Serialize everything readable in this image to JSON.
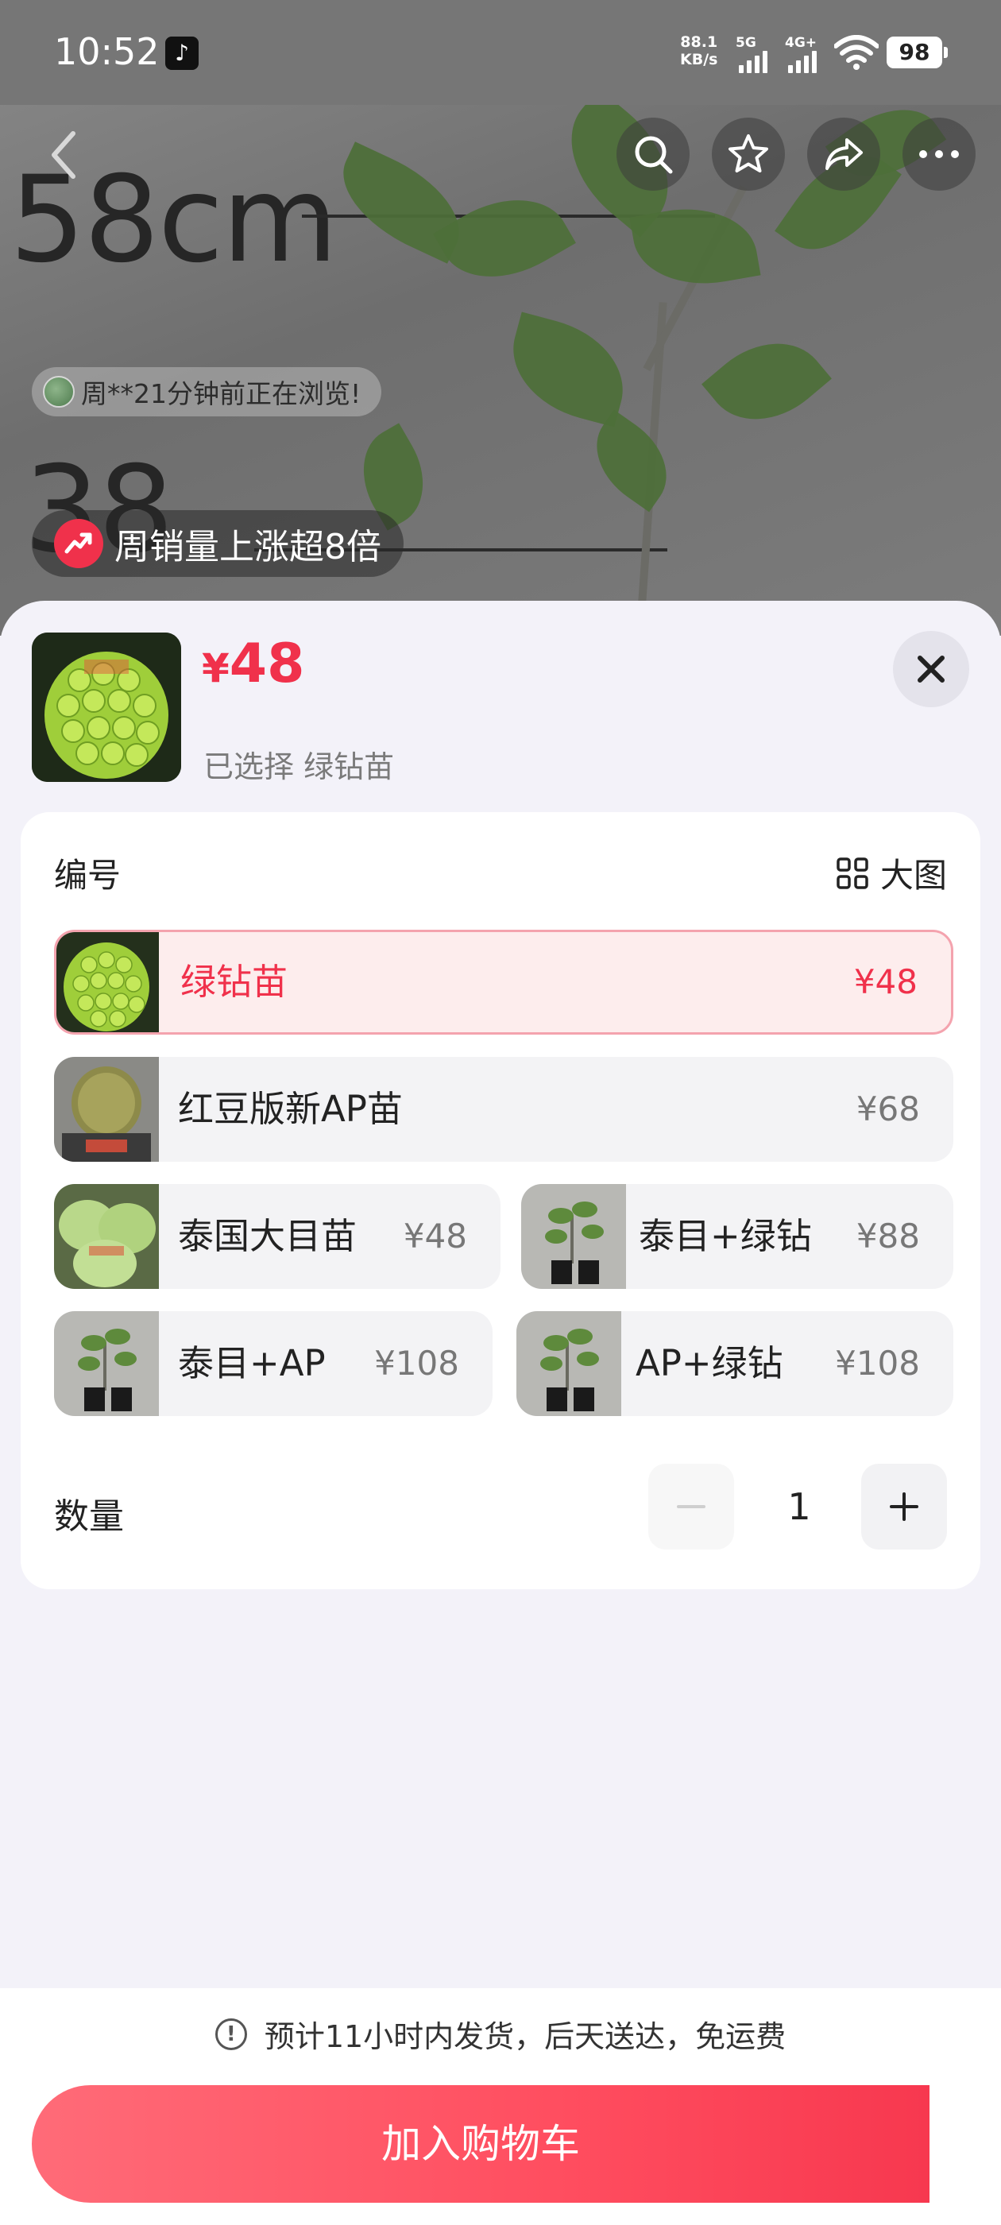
{
  "status_bar": {
    "time": "10:52",
    "net_speed_value": "88.1",
    "net_speed_unit": "KB/s",
    "signal1_label": "5G",
    "signal2_label": "4G+",
    "battery": "98"
  },
  "photo": {
    "ruler_top": "58cm",
    "ruler_mid": "38"
  },
  "top_actions": [
    "back",
    "search",
    "favorite",
    "share",
    "more"
  ],
  "viewer_notice": "周**21分钟前正在浏览!",
  "sales_badge": "周销量上涨超8倍",
  "sheet": {
    "price_symbol": "¥",
    "price": "48",
    "selected_text": "已选择 绿钻苗",
    "section_label": "编号",
    "big_image_label": "大图",
    "options": [
      {
        "name": "绿钻苗",
        "price": "¥48",
        "selected": true
      },
      {
        "name": "红豆版新AP苗",
        "price": "¥68",
        "selected": false
      },
      {
        "name": "泰国大目苗",
        "price": "¥48",
        "selected": false
      },
      {
        "name": "泰目+绿钻",
        "price": "¥88",
        "selected": false
      },
      {
        "name": "泰目+AP",
        "price": "¥108",
        "selected": false
      },
      {
        "name": "AP+绿钻",
        "price": "¥108",
        "selected": false
      }
    ],
    "quantity_label": "数量",
    "quantity": "1"
  },
  "shipping_text": "预计11小时内发货，后天送达，免运费",
  "add_to_cart": "加入购物车",
  "colors": {
    "accent": "#f0314b",
    "cart_button": "#ff4d5f",
    "sheet_bg": "#f3f2f9"
  }
}
